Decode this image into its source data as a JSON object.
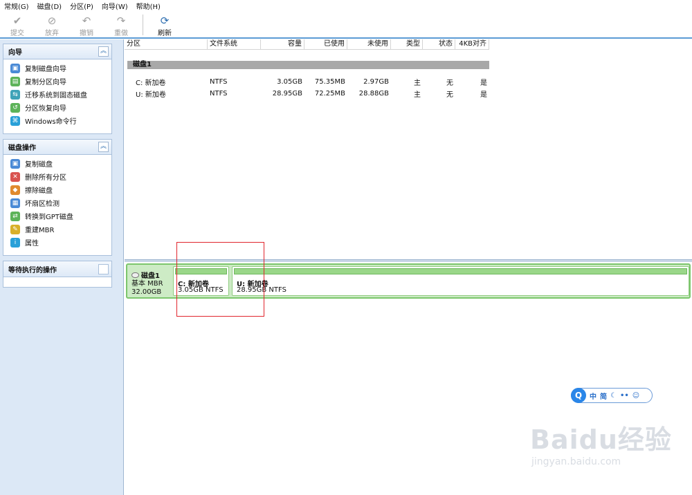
{
  "menu": [
    "常规(G)",
    "磁盘(D)",
    "分区(P)",
    "向导(W)",
    "帮助(H)"
  ],
  "toolbar": {
    "buttons": [
      {
        "label": "提交",
        "icon": "check-icon",
        "enabled": false
      },
      {
        "label": "放弃",
        "icon": "discard-icon",
        "enabled": false
      },
      {
        "label": "撤销",
        "icon": "undo-icon",
        "enabled": false
      },
      {
        "label": "重做",
        "icon": "redo-icon",
        "enabled": false
      },
      {
        "label": "刷新",
        "icon": "refresh-icon",
        "enabled": true
      }
    ]
  },
  "sidebar": {
    "wizard": {
      "title": "向导",
      "items": [
        {
          "label": "复制磁盘向导",
          "icon": "copy-disk-icon"
        },
        {
          "label": "复制分区向导",
          "icon": "copy-partition-icon"
        },
        {
          "label": "迁移系统到固态磁盘",
          "icon": "migrate-os-icon"
        },
        {
          "label": "分区恢复向导",
          "icon": "partition-recovery-icon"
        },
        {
          "label": "Windows命令行",
          "icon": "command-line-icon"
        }
      ]
    },
    "disk_ops": {
      "title": "磁盘操作",
      "items": [
        {
          "label": "复制磁盘",
          "icon": "copy-disk-icon"
        },
        {
          "label": "删除所有分区",
          "icon": "delete-partitions-icon"
        },
        {
          "label": "擦除磁盘",
          "icon": "wipe-disk-icon"
        },
        {
          "label": "坏扇区检测",
          "icon": "surface-test-icon"
        },
        {
          "label": "转换到GPT磁盘",
          "icon": "convert-gpt-icon"
        },
        {
          "label": "重建MBR",
          "icon": "rebuild-mbr-icon"
        },
        {
          "label": "属性",
          "icon": "properties-icon"
        }
      ]
    },
    "pending": {
      "title": "等待执行的操作"
    }
  },
  "table": {
    "columns": [
      "分区",
      "文件系统",
      "容量",
      "已使用",
      "未使用",
      "类型",
      "状态",
      "4KB对齐"
    ],
    "disk_label": "磁盘1",
    "rows": [
      {
        "partition": "C: 新加卷",
        "fs": "NTFS",
        "capacity": "3.05GB",
        "used": "75.35MB",
        "unused": "2.97GB",
        "type": "主",
        "status": "无",
        "aligned": "是"
      },
      {
        "partition": "U: 新加卷",
        "fs": "NTFS",
        "capacity": "28.95GB",
        "used": "72.25MB",
        "unused": "28.88GB",
        "type": "主",
        "status": "无",
        "aligned": "是"
      }
    ]
  },
  "diskmap": {
    "disk_name": "磁盘1",
    "disk_type": "基本 MBR",
    "disk_size": "32.00GB",
    "partitions": [
      {
        "name": "C: 新加卷",
        "desc": "3.05GB NTFS"
      },
      {
        "name": "U: 新加卷",
        "desc": "28.95GB NTFS"
      }
    ]
  },
  "ime": {
    "logo": "Q",
    "lang": "中",
    "mode": "简"
  },
  "watermark": {
    "brand": "Baidu经验",
    "url": "jingyan.baidu.com"
  },
  "colors": {
    "accent": "#5b9bd5",
    "partition_fill": "#9ad789",
    "highlight": "#e0242c"
  }
}
